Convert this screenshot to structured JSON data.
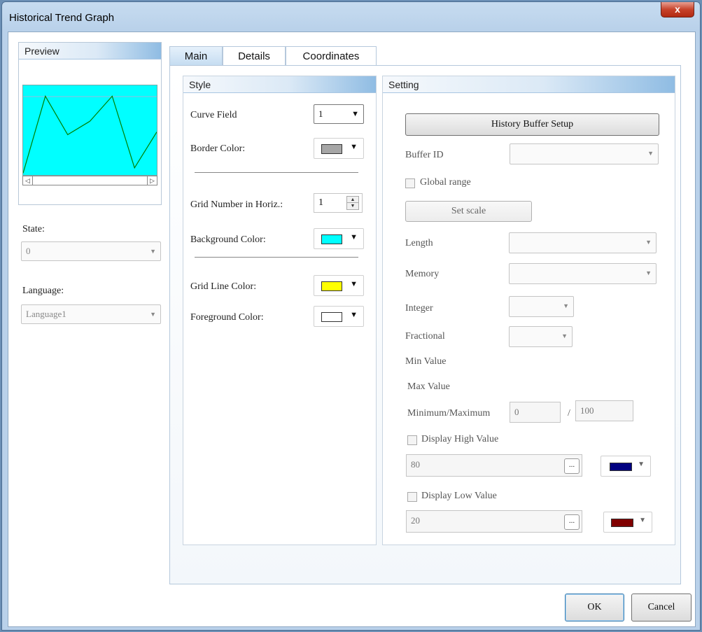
{
  "window": {
    "title": "Historical Trend Graph",
    "close_glyph": "x"
  },
  "preview": {
    "title": "Preview",
    "graph": {
      "background": "#00ffff",
      "grid_line_color": "#ffff00",
      "curve_color": "#008000",
      "curve": [
        0.02,
        0.88,
        0.45,
        0.6,
        0.88,
        0.08,
        0.48
      ]
    }
  },
  "left": {
    "state_label": "State:",
    "state_value": "0",
    "language_label": "Language:",
    "language_value": "Language1"
  },
  "tabs": [
    {
      "label": "Main",
      "active": true
    },
    {
      "label": "Details",
      "active": false
    },
    {
      "label": "Coordinates",
      "active": false
    }
  ],
  "style": {
    "title": "Style",
    "curve_field_label": "Curve Field",
    "curve_field_value": "1",
    "border_color_label": "Border Color:",
    "border_color": "#a6a6a6",
    "grid_number_label": "Grid Number in Horiz.:",
    "grid_number_value": "1",
    "background_color_label": "Background Color:",
    "background_color": "#00ffff",
    "grid_line_color_label": "Grid Line Color:",
    "grid_line_color": "#ffff00",
    "foreground_color_label": "Foreground Color:",
    "foreground_color": "#ffffff"
  },
  "setting": {
    "title": "Setting",
    "history_buffer_button": "History Buffer Setup",
    "buffer_id_label": "Buffer ID",
    "global_range_label": "Global range",
    "set_scale_button": "Set scale",
    "length_label": "Length",
    "memory_label": "Memory",
    "integer_label": "Integer",
    "fractional_label": "Fractional",
    "min_value_label": "Min Value",
    "max_value_label": "Max Value",
    "min_max_label": "Minimum/Maximum",
    "minimum_value": "0",
    "separator": "/",
    "maximum_value": "100",
    "display_high_label": "Display High Value",
    "high_value": "80",
    "high_color": "#000080",
    "display_low_label": "Display Low Value",
    "low_value": "20",
    "low_color": "#800000",
    "ellipsis": "..."
  },
  "buttons": {
    "ok": "OK",
    "cancel": "Cancel"
  }
}
